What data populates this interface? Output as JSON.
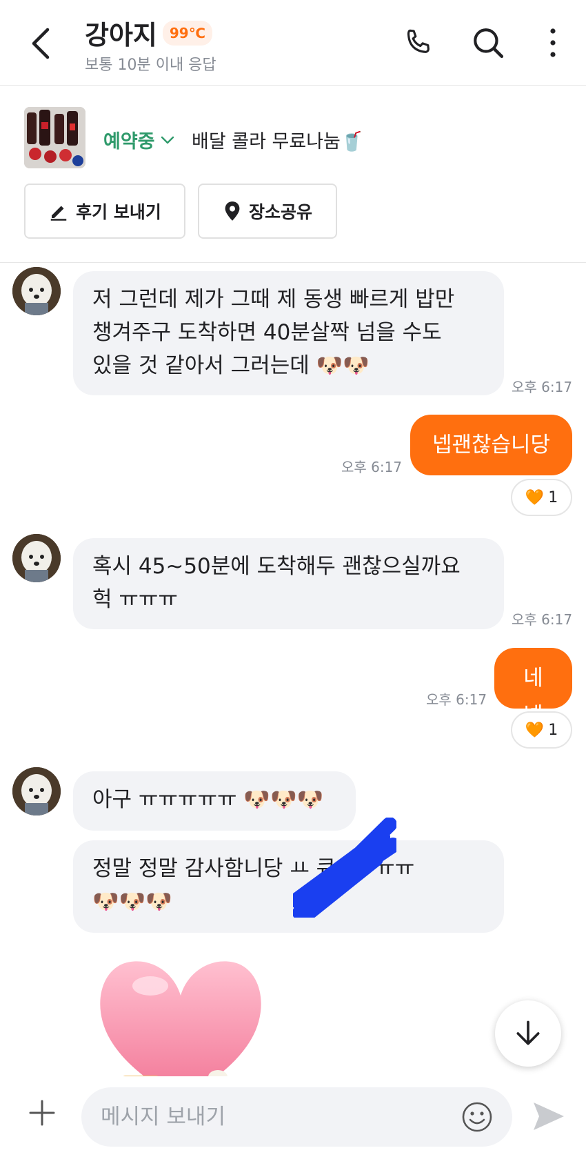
{
  "header": {
    "title": "강아지",
    "temperature": "99℃",
    "subtitle": "보통 10분 이내 응답",
    "icons": [
      "back-arrow-icon",
      "phone-icon",
      "search-icon",
      "more-vertical-icon"
    ]
  },
  "product": {
    "status": "예약중",
    "title": "배달 콜라 무료나눔🥤",
    "buttons": [
      {
        "label": "후기 보내기",
        "icon": "pencil-icon"
      },
      {
        "label": "장소공유",
        "icon": "location-pin-icon"
      }
    ]
  },
  "messages": [
    {
      "from": "other",
      "lines": [
        "저 그런데 제가 그때 제 동생 빠르게 밥만",
        "챙겨주구 도착하면 40분살짝 넘을 수도",
        "있을 것 같아서 그러는데 🐶🐶"
      ],
      "time": "오후 6:17"
    },
    {
      "from": "me",
      "text": "넵괜찮습니당",
      "time": "오후 6:17",
      "reaction": {
        "emoji": "🧡",
        "count": "1"
      }
    },
    {
      "from": "other",
      "lines": [
        "혹시 45~50분에 도착해두 괜찮으실까요",
        "헉 ㅠㅠㅠ"
      ],
      "time": "오후 6:17"
    },
    {
      "from": "me",
      "text": "네넵",
      "time": "오후 6:17",
      "reaction": {
        "emoji": "🧡",
        "count": "1"
      }
    },
    {
      "from": "other",
      "lines": [
        "아구 ㅠㅠㅠㅠㅠ 🐶🐶🐶"
      ]
    },
    {
      "from": "other",
      "lines": [
        "정말 정말 감사함니당 ㅛ   큐ㅠㅠㅠㅠ",
        "🐶🐶🐶"
      ]
    }
  ],
  "composer": {
    "placeholder": "메시지 보내기",
    "icons": [
      "plus-icon",
      "emoji-icon",
      "send-icon"
    ]
  },
  "colors": {
    "accent": "#ff6f0f",
    "status_green": "#2f9a6b",
    "bubble_in": "#f2f3f6",
    "scribble": "#1a3ff0"
  }
}
